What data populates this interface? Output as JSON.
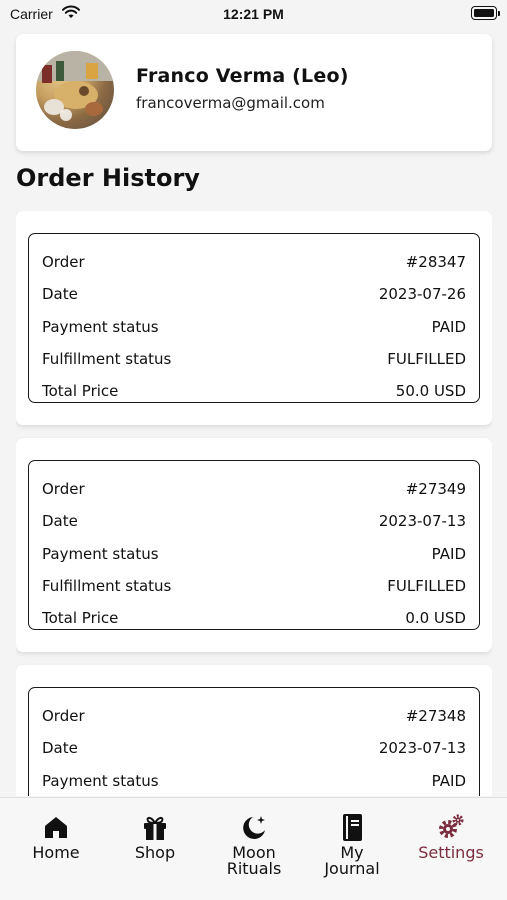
{
  "status_bar": {
    "carrier": "Carrier",
    "time": "12:21 PM"
  },
  "profile": {
    "name": "Franco Verma (Leo)",
    "email": "francoverma@gmail.com"
  },
  "section_title": "Order History",
  "order_labels": {
    "order": "Order",
    "date": "Date",
    "payment_status": "Payment status",
    "fulfillment_status": "Fulfillment status",
    "total_price": "Total Price"
  },
  "orders": [
    {
      "order": "#28347",
      "date": "2023-07-26",
      "payment_status": "PAID",
      "fulfillment_status": "FULFILLED",
      "total_price": "50.0 USD"
    },
    {
      "order": "#27349",
      "date": "2023-07-13",
      "payment_status": "PAID",
      "fulfillment_status": "FULFILLED",
      "total_price": "0.0 USD"
    },
    {
      "order": "#27348",
      "date": "2023-07-13",
      "payment_status": "PAID"
    }
  ],
  "tabs": [
    {
      "label": "Home",
      "icon": "home-icon",
      "active": false
    },
    {
      "label": "Shop",
      "icon": "gift-icon",
      "active": false
    },
    {
      "label": "Moon\nRituals",
      "icon": "moon-stars-icon",
      "active": false
    },
    {
      "label": "My\nJournal",
      "icon": "journal-icon",
      "active": false
    },
    {
      "label": "Settings",
      "icon": "gears-icon",
      "active": true
    }
  ],
  "colors": {
    "accent": "#7a2d3d",
    "card_bg": "#ffffff",
    "page_bg": "#f4f4f4"
  }
}
